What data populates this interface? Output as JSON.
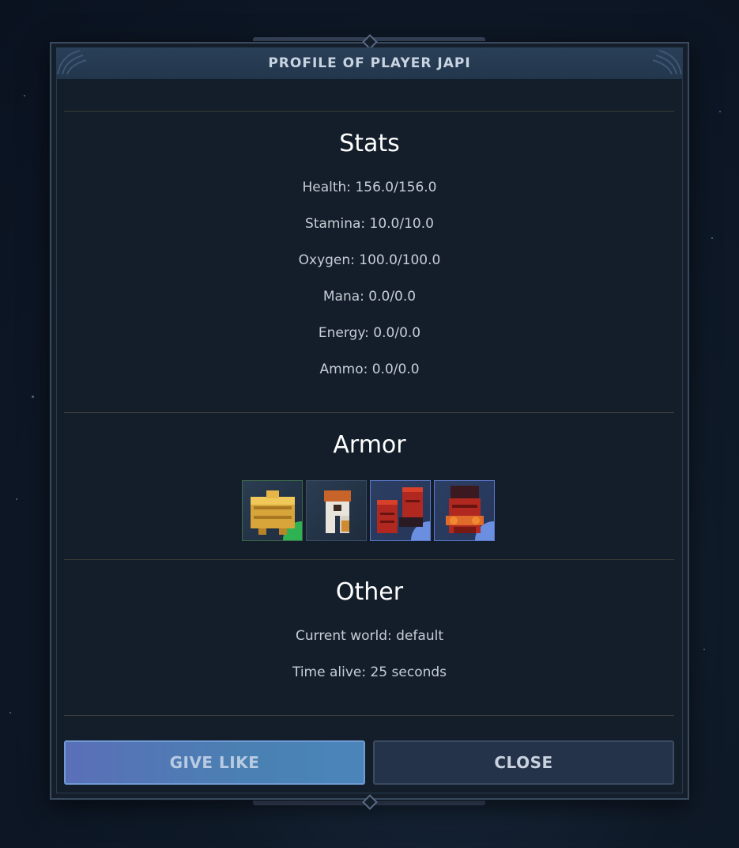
{
  "dialog": {
    "title": "PROFILE OF PLAYER JAPI"
  },
  "stats": {
    "heading": "Stats",
    "lines": [
      "Health: 156.0/156.0",
      "Stamina: 10.0/10.0",
      "Oxygen: 100.0/100.0",
      "Mana: 0.0/0.0",
      "Energy: 0.0/0.0",
      "Ammo: 0.0/0.0"
    ]
  },
  "armor": {
    "heading": "Armor",
    "slots": [
      {
        "icon": "gold-chestplate-icon",
        "rarity": "uncommon",
        "accent": "#2fb352"
      },
      {
        "icon": "white-orange-leggings-icon",
        "rarity": "common",
        "accent": "#2b3d52"
      },
      {
        "icon": "red-boots-icon",
        "rarity": "rare",
        "accent": "#6a8fe0"
      },
      {
        "icon": "red-armor-icon",
        "rarity": "rare",
        "accent": "#6a8fe0"
      }
    ]
  },
  "other": {
    "heading": "Other",
    "lines": [
      "Current world: default",
      "Time alive: 25 seconds"
    ]
  },
  "buttons": {
    "give_like": "GIVE LIKE",
    "close": "CLOSE"
  }
}
